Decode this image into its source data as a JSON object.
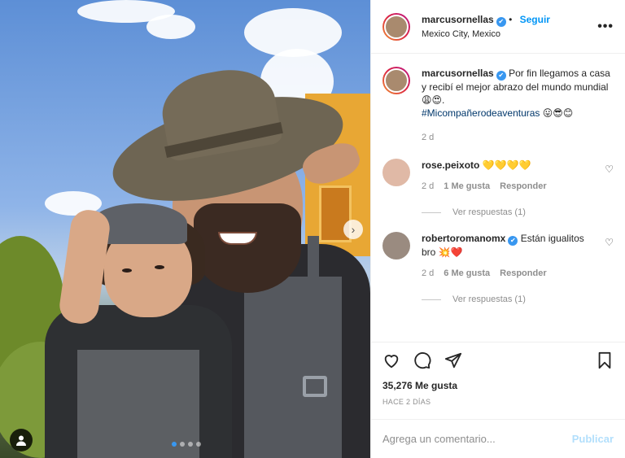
{
  "post": {
    "author": "marcusornellas",
    "follow_label": "Seguir",
    "location": "Mexico City, Mexico",
    "more_label": "•••",
    "caption_text": "Por fin llegamos a casa y recibí el mejor abrazo del mundo mundial",
    "caption_emojis": "😩😍.",
    "hashtag": "#Micompañerodeaventuras",
    "hashtag_emojis": "😛😎😊",
    "caption_age": "2 d",
    "likes": "35,276 Me gusta",
    "posted": "HACE 2 DÍAS"
  },
  "comments": [
    {
      "user": "rose.peixoto",
      "text": "",
      "emojis": "💛💛💛💛",
      "age": "2 d",
      "likes": "1 Me gusta",
      "reply_label": "Responder",
      "view_replies": "Ver respuestas (1)"
    },
    {
      "user": "robertoromanomx",
      "text": "Están igualitos bro",
      "emojis": "💥❤️",
      "age": "2 d",
      "likes": "6 Me gusta",
      "reply_label": "Responder",
      "view_replies": "Ver respuestas (1)"
    }
  ],
  "composer": {
    "placeholder": "Agrega un comentario...",
    "submit_label": "Publicar"
  },
  "carousel": {
    "slides": 4,
    "active": 1,
    "next_glyph": "›"
  },
  "colors": {
    "accent": "#0095f6",
    "verified": "#3897f0",
    "muted": "#8e8e8e"
  },
  "icons": [
    "heart-icon",
    "comment-icon",
    "share-icon",
    "bookmark-icon",
    "user-tag-icon",
    "chevron-right-icon",
    "more-icon",
    "verified-icon"
  ]
}
